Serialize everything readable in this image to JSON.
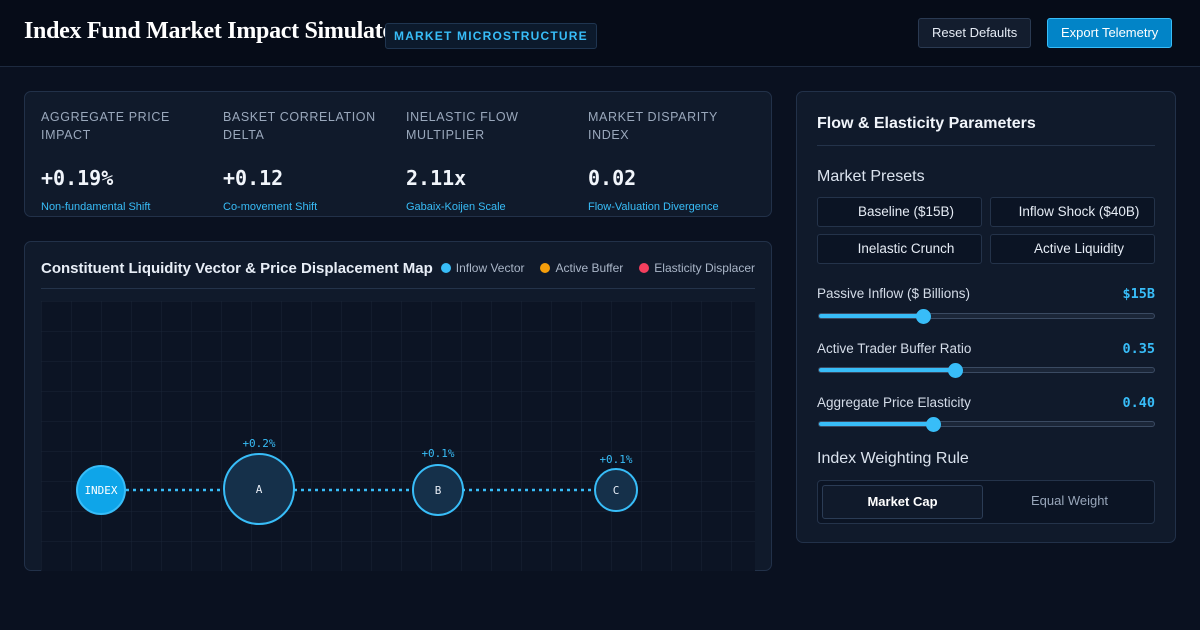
{
  "header": {
    "title": "Index Fund Market Impact Simulator",
    "tag": "MARKET MICROSTRUCTURE",
    "reset_label": "Reset Defaults",
    "export_label": "Export Telemetry"
  },
  "metrics": [
    {
      "label": "AGGREGATE PRICE IMPACT",
      "value": "+0.19%",
      "sub": "Non-fundamental Shift"
    },
    {
      "label": "BASKET CORRELATION DELTA",
      "value": "+0.12",
      "sub": "Co-movement Shift"
    },
    {
      "label": "INELASTIC FLOW MULTIPLIER",
      "value": "2.11x",
      "sub": "Gabaix-Koijen Scale"
    },
    {
      "label": "MARKET DISPARITY INDEX",
      "value": "0.02",
      "sub": "Flow-Valuation Divergence"
    }
  ],
  "map": {
    "title": "Constituent Liquidity Vector & Price Displacement Map",
    "legend": [
      {
        "label": "Inflow Vector",
        "color": "#38bdf8"
      },
      {
        "label": "Active Buffer",
        "color": "#f59e0b"
      },
      {
        "label": "Elasticity Displacer",
        "color": "#f43f5e"
      }
    ],
    "nodes": [
      {
        "label": "INDEX",
        "change": "",
        "kind": "index"
      },
      {
        "label": "A",
        "change": "+0.2%",
        "kind": "constituent"
      },
      {
        "label": "B",
        "change": "+0.1%",
        "kind": "constituent"
      },
      {
        "label": "C",
        "change": "+0.1%",
        "kind": "constituent"
      }
    ]
  },
  "params": {
    "title": "Flow & Elasticity Parameters",
    "presets_title": "Market Presets",
    "presets": [
      "Baseline ($15B)",
      "Inflow Shock ($40B)",
      "Inelastic Crunch",
      "Active Liquidity"
    ],
    "sliders": [
      {
        "label": "Passive Inflow ($ Billions)",
        "value": "$15B",
        "fraction": 0.31
      },
      {
        "label": "Active Trader Buffer Ratio",
        "value": "0.35",
        "fraction": 0.405
      },
      {
        "label": "Aggregate Price Elasticity",
        "value": "0.40",
        "fraction": 0.34
      }
    ],
    "weighting_title": "Index Weighting Rule",
    "weighting_options": [
      "Market Cap",
      "Equal Weight"
    ],
    "weighting_selected": "Market Cap"
  },
  "colors": {
    "accent": "#38bdf8",
    "accent_dark": "#0284c7",
    "node_index_fill": "#0ea5e9",
    "background": "#0a1120"
  }
}
